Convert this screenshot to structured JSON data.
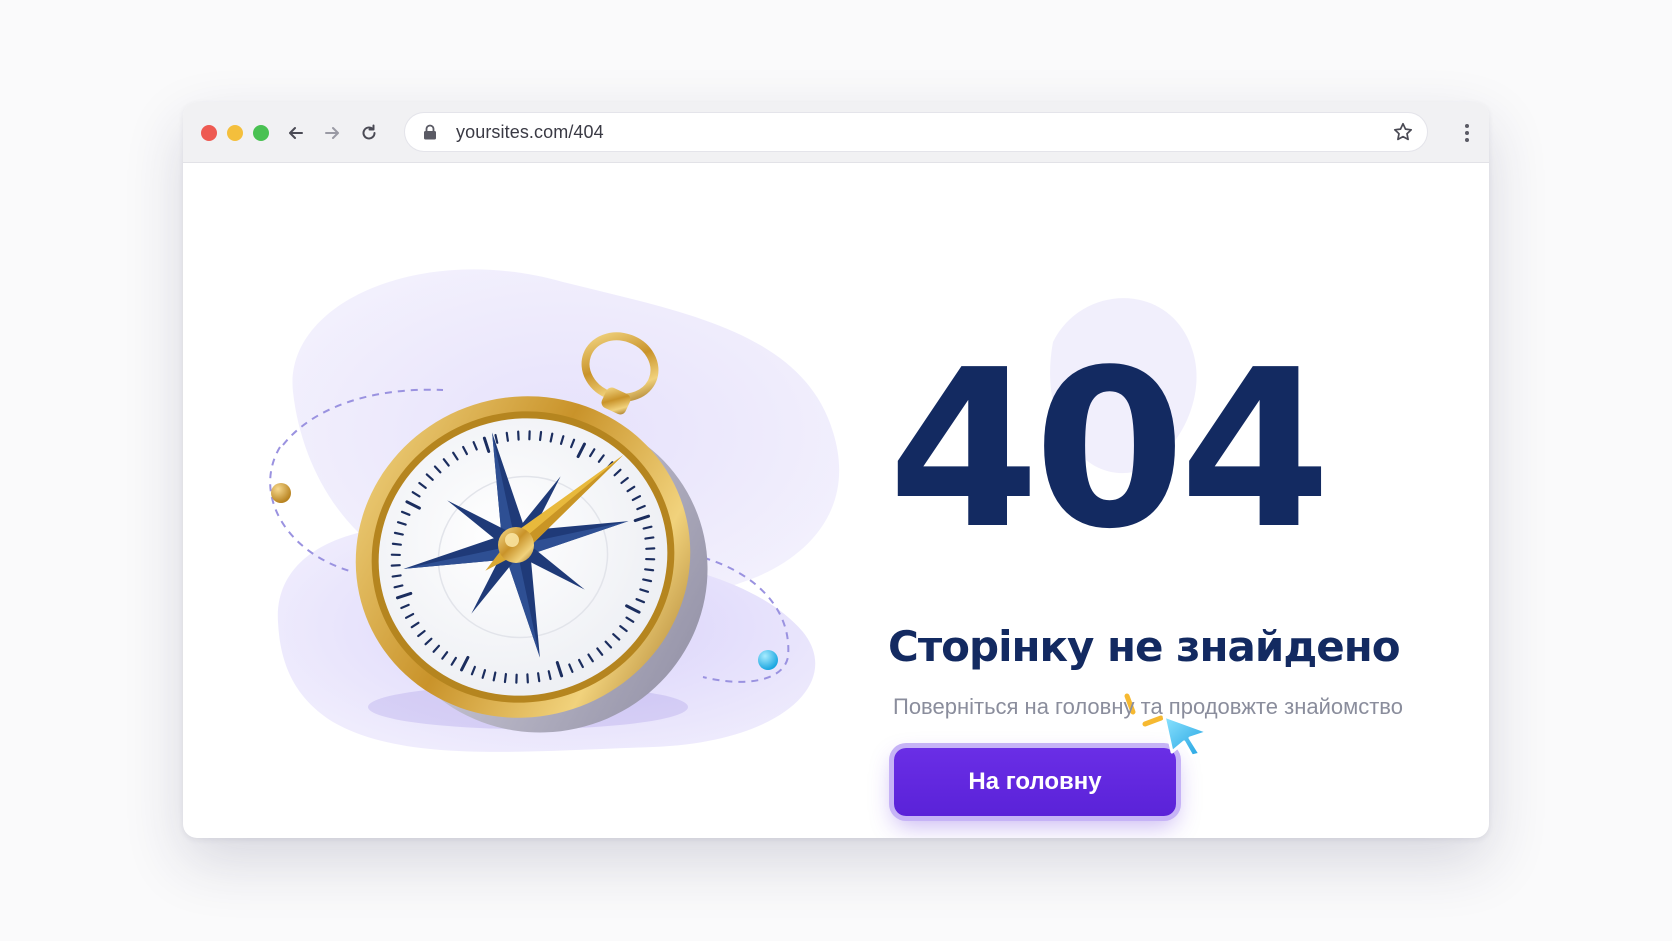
{
  "browser": {
    "url": "yoursites.com/404",
    "icons": {
      "back": "arrow-left-icon",
      "forward": "arrow-right-icon",
      "reload": "reload-icon",
      "lock": "lock-icon",
      "bookmark": "star-icon",
      "menu": "kebab-menu-icon"
    },
    "traffic_lights": [
      "#ee5a52",
      "#f4bf3c",
      "#49c152"
    ]
  },
  "page": {
    "code": "404",
    "title": "Сторінку не знайдено",
    "subtitle": "Поверніться на головну та продовжте знайомство",
    "button_label": "На головну"
  },
  "colors": {
    "navy": "#132a61",
    "accent_purple": "#5a22d8",
    "compass_gold": "#d8a93a",
    "blob_lavender": "#ece8fb"
  }
}
